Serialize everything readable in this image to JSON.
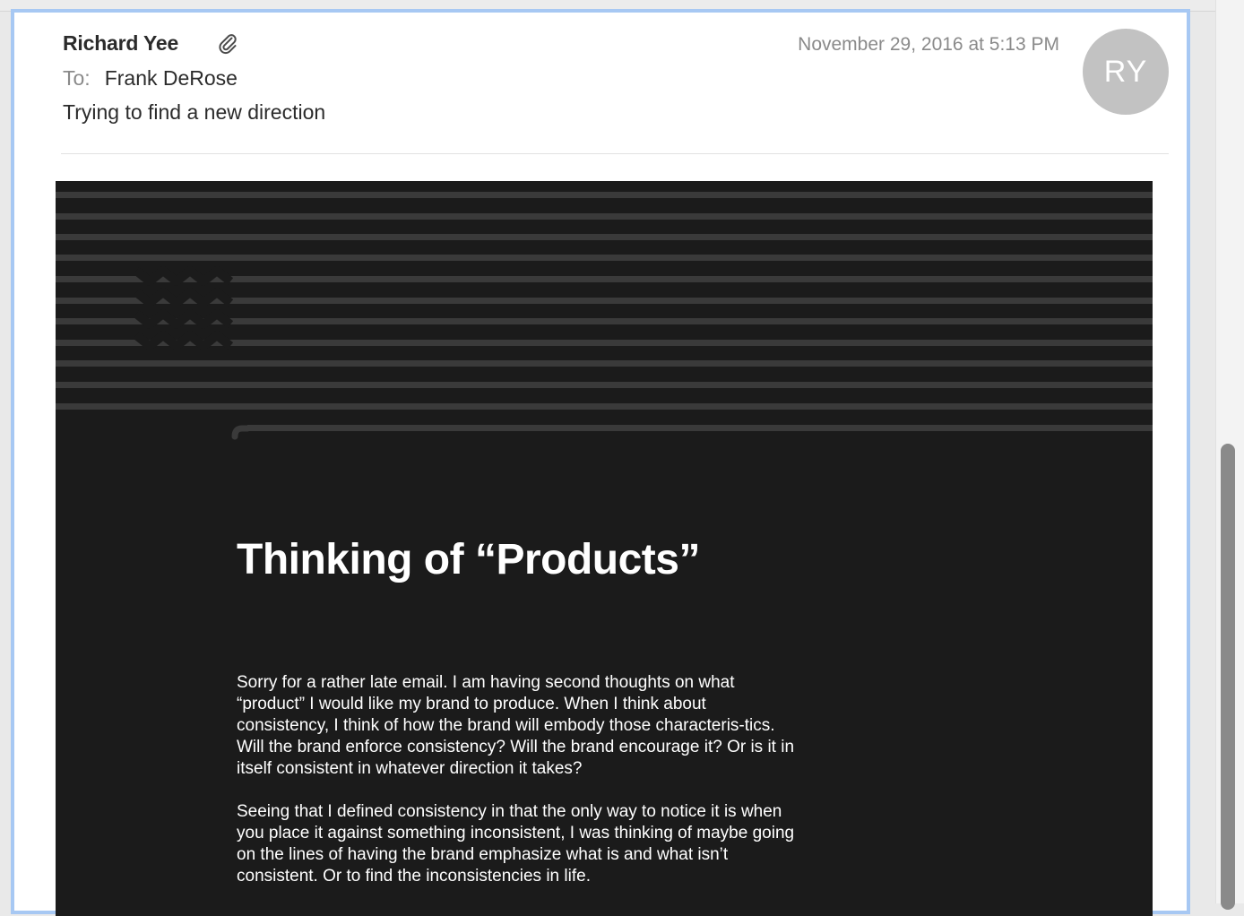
{
  "message": {
    "sender": "Richard Yee",
    "date": "November 29, 2016 at 5:13 PM",
    "to_label": "To:",
    "to_name": "Frank DeRose",
    "subject": "Trying to find a new direction",
    "avatar_initials": "RY"
  },
  "icons": {
    "attachment": "paperclip-icon"
  },
  "body": {
    "headline": "Thinking of “Products”",
    "paragraphs": [
      "Sorry for a rather late email. I am having second thoughts on what “product” I would like my brand to produce. When I think about consistency, I think of how the brand will embody those characteris-tics. Will the brand enforce consistency? Will the brand encourage it? Or is it in itself consistent in whatever direction it takes?",
      "Seeing that I defined consistency in that the only way to notice it is when you place it against something inconsistent, I was thinking of maybe going on the lines of having the brand emphasize what is and what isn’t consistent. Or to find the inconsistencies in life."
    ]
  },
  "colors": {
    "selection_border": "#a7c8f3",
    "email_background": "#1b1b1b",
    "stripe": "#3a3a3a",
    "avatar": "#c2c2c2"
  }
}
